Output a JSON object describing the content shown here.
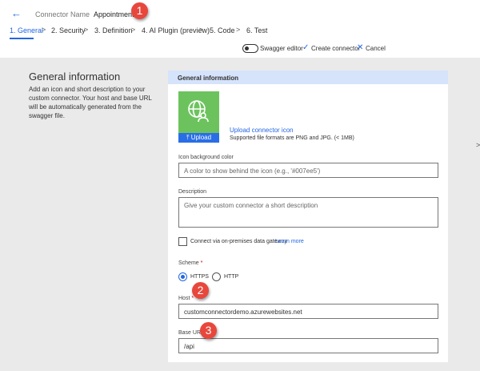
{
  "header": {
    "connector_name_label": "Connector Name",
    "connector_name": "Appointment"
  },
  "tabs": [
    {
      "label": "1. General",
      "active": true
    },
    {
      "label": "2. Security"
    },
    {
      "label": "3. Definition"
    },
    {
      "label": "4. AI Plugin (preview)"
    },
    {
      "label": "5. Code"
    },
    {
      "label": "6. Test"
    }
  ],
  "toolbar": {
    "swagger_editor": "Swagger editor",
    "swagger_on": false,
    "create": "Create connector",
    "cancel": "Cancel"
  },
  "left": {
    "title": "General information",
    "description": "Add an icon and short description to your custom connector. Your host and base URL will be automatically generated from the swagger file."
  },
  "card": {
    "title": "General information",
    "upload_button": "Upload",
    "upload_link": "Upload connector icon",
    "upload_hint": "Supported file formats are PNG and JPG. (< 1MB)",
    "icon_bg_label": "Icon background color",
    "icon_bg_placeholder": "A color to show behind the icon (e.g., '#007ee5')",
    "desc_label": "Description",
    "desc_placeholder": "Give your custom connector a short description",
    "gateway_label": "Connect via on-premises data gateway",
    "gateway_checked": false,
    "learn_more": "Learn more",
    "scheme_label": "Scheme",
    "required": "*",
    "scheme_options": [
      "HTTPS",
      "HTTP"
    ],
    "scheme_selected": "HTTPS",
    "host_label": "Host",
    "host_value": "customconnectordemo.azurewebsites.net",
    "base_url_label": "Base URL",
    "base_url_value": "/api"
  },
  "badges": [
    "1",
    "2",
    "3"
  ],
  "colors": {
    "accent": "#2266e3",
    "icon_bg": "#6cc35e",
    "badge": "#e8473c",
    "card_header": "#d5e3fb"
  }
}
